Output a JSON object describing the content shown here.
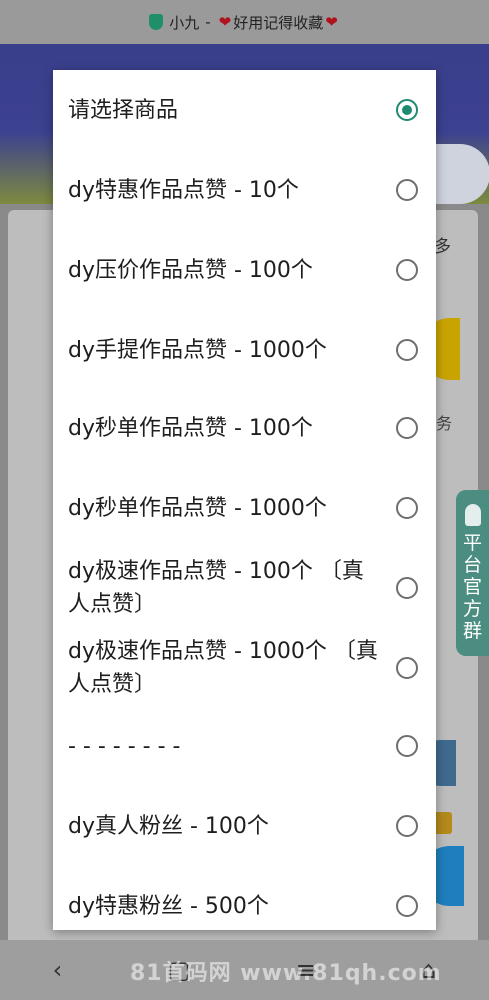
{
  "status_bar": {
    "app": "小九",
    "separator": "-",
    "tagline": "好用记得收藏"
  },
  "background": {
    "more_tab": "多",
    "task_label": "务",
    "side_tab": [
      "平",
      "台",
      "官",
      "方",
      "群"
    ]
  },
  "dialog": {
    "options": [
      {
        "label": "请选择商品",
        "selected": true
      },
      {
        "label": "dy特惠作品点赞 - 10个",
        "selected": false
      },
      {
        "label": "dy压价作品点赞 - 100个",
        "selected": false
      },
      {
        "label": "dy手提作品点赞 - 1000个",
        "selected": false
      },
      {
        "label": "dy秒单作品点赞 - 100个",
        "selected": false
      },
      {
        "label": "dy秒单作品点赞 - 1000个",
        "selected": false
      },
      {
        "label": "dy极速作品点赞 - 100个 〔真人点赞〕",
        "selected": false
      },
      {
        "label": "dy极速作品点赞 - 1000个 〔真人点赞〕",
        "selected": false
      },
      {
        "label": "- - - - - - - -",
        "selected": false
      },
      {
        "label": "dy真人粉丝 - 100个",
        "selected": false
      },
      {
        "label": "dy特惠粉丝 - 500个",
        "selected": false
      }
    ]
  },
  "nav": {
    "back": "‹",
    "home": "⌂",
    "menu": "≡",
    "recent": "▢"
  },
  "watermark": "81首码网 www.81qh.com",
  "colors": {
    "accent": "#1e8a70",
    "header": "#3c4190",
    "side_tab": "#4b8d80"
  }
}
